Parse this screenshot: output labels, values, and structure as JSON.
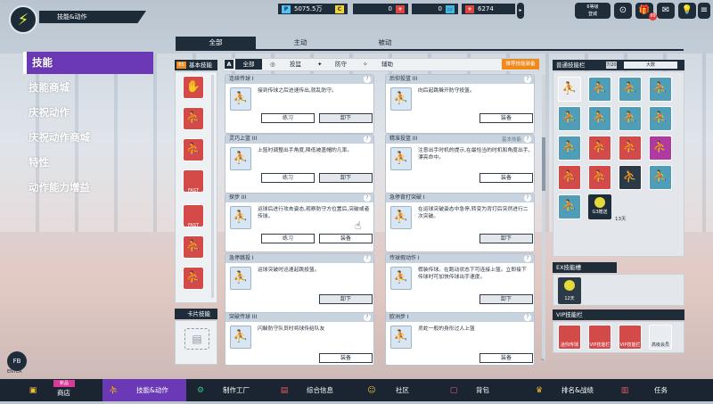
{
  "header": {
    "section_title": "技能&动作"
  },
  "currency": {
    "points": {
      "tag": "P",
      "value": "5075.5万"
    },
    "coins": {
      "tag": "C",
      "value": "0"
    },
    "bux": {
      "value": "0"
    },
    "tickets": {
      "value": "6274"
    }
  },
  "top_right": {
    "level_label": "6等级\n登城",
    "level_num": "65",
    "badge": "99"
  },
  "left_menu": [
    {
      "label": "技能"
    },
    {
      "label": "技能商城"
    },
    {
      "label": "庆祝动作"
    },
    {
      "label": "庆祝动作商城"
    },
    {
      "label": "特性"
    },
    {
      "label": "动作能力增益"
    }
  ],
  "tabs": [
    "全部",
    "主动",
    "被动"
  ],
  "base_panel": {
    "title": "基本技能",
    "badge": "BS",
    "icons": [
      "",
      "",
      "",
      "FAST",
      "FAST",
      "",
      ""
    ]
  },
  "card_panel": {
    "title": "卡片技能"
  },
  "filters": {
    "all_mark": "A",
    "all": "全部",
    "shoot": "投篮",
    "defense": "防守",
    "assist": "辅助",
    "recommend": "推荐技能装备"
  },
  "cards": [
    {
      "title": "连续传球 I",
      "desc": "接到传球之后进速传出,就乱防守。",
      "b1": "练习",
      "b2": "卸下"
    },
    {
      "title": "后仰投篮 III",
      "desc": "向后起跳躲开防守投篮。",
      "b1": "",
      "b2": "装备"
    },
    {
      "title": "灵巧上篮 III",
      "desc": "上篮时调整出手角度,降低被盖帽的几率。",
      "b1": "练习",
      "b2": "卸下"
    },
    {
      "title": "精准投篮 III",
      "desc": "注意出手时机的提示,在最恰当的时机和角度出手,漂亮命中。",
      "b1": "",
      "b2": "装备",
      "tag": "基本技能"
    },
    {
      "title": "探步 III",
      "desc": "运球后进行攻击姿态,观察防守方位置后,突破或者传球。",
      "b1": "练习",
      "b2": "装备"
    },
    {
      "title": "急停背打突破 I",
      "desc": "在运球突破姿态中急停,转变为背打后突然进行二次突破。",
      "b1": "",
      "b2": "卸下"
    },
    {
      "title": "急停跳投 I",
      "desc": "运球突破时迅速起跳投篮。",
      "b1": "",
      "b2": "卸下"
    },
    {
      "title": "传球假动作 I",
      "desc": "假装传球。在跑动状态下可连接上篮。立即接下传球时可加快传球出手速度。",
      "b1": "",
      "b2": "卸下"
    },
    {
      "title": "突破传球 III",
      "desc": "闪躲防守队员时将球传给队友",
      "b1": "",
      "b2": "装备"
    },
    {
      "title": "欧洲步 I",
      "desc": "灵蛇一般的身形过人上篮",
      "b1": "",
      "b2": "装备"
    }
  ],
  "right_panel": {
    "title": "普通技能栏",
    "count": "7/20",
    "sort": "大数",
    "time_badge": "13天",
    "g_label": "G3赠送",
    "ex_title": "EX技能槽",
    "ex_days": "12天",
    "vip_title": "VIP技能栏",
    "vip_items": [
      "迷你传球包",
      "VIP技能栏",
      "VIP技能栏",
      "高级会员"
    ]
  },
  "footer": {
    "fb": "FB",
    "enter": "ENTER"
  },
  "bottom_nav": [
    {
      "label": "商店",
      "badge": "新品",
      "icon": "shop-icon"
    },
    {
      "label": "技能&动作",
      "icon": "skill-icon"
    },
    {
      "label": "制作工厂",
      "icon": "factory-icon"
    },
    {
      "label": "综合信息",
      "icon": "info-icon"
    },
    {
      "label": "社区",
      "icon": "community-icon"
    },
    {
      "label": "背包",
      "icon": "bag-icon"
    },
    {
      "label": "排名&战绩",
      "icon": "trophy-icon"
    },
    {
      "label": "任务",
      "icon": "mission-icon"
    }
  ]
}
